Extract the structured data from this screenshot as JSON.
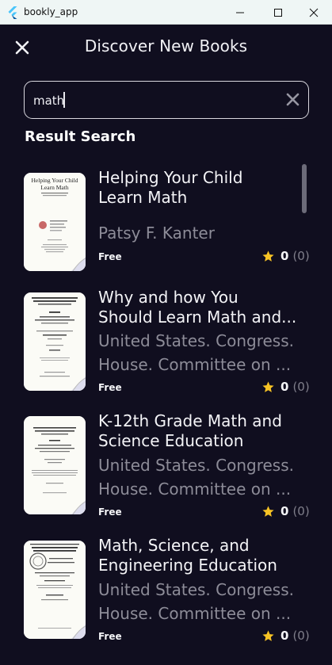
{
  "window": {
    "title": "bookly_app"
  },
  "header": {
    "title": "Discover New Books",
    "close_icon": "close-icon"
  },
  "search": {
    "value": "math",
    "placeholder": ""
  },
  "section": {
    "title": "Result Search"
  },
  "books": [
    {
      "title_lines": [
        "Helping Your Child",
        "Learn Math"
      ],
      "author_lines": [
        "Patsy F. Kanter"
      ],
      "price": "Free",
      "rating": "0",
      "rating_count": "(0)"
    },
    {
      "title_lines": [
        "Why and how You",
        "Should Learn Math and..."
      ],
      "author_lines": [
        "United States. Congress.",
        "House. Committee on ..."
      ],
      "price": "Free",
      "rating": "0",
      "rating_count": "(0)"
    },
    {
      "title_lines": [
        "K-12th Grade Math and",
        "Science Education"
      ],
      "author_lines": [
        "United States. Congress.",
        "House. Committee on ..."
      ],
      "price": "Free",
      "rating": "0",
      "rating_count": "(0)"
    },
    {
      "title_lines": [
        "Math, Science, and",
        "Engineering Education"
      ],
      "author_lines": [
        "United States. Congress.",
        "House. Committee on ..."
      ],
      "price": "Free",
      "rating": "0",
      "rating_count": "(0)"
    }
  ],
  "covers": {
    "book1_title_lines": [
      "Helping Your Child",
      "Learn Math"
    ]
  },
  "colors": {
    "background": "#100e1f",
    "star": "#f7c325",
    "muted_text": "#8d8c98"
  }
}
